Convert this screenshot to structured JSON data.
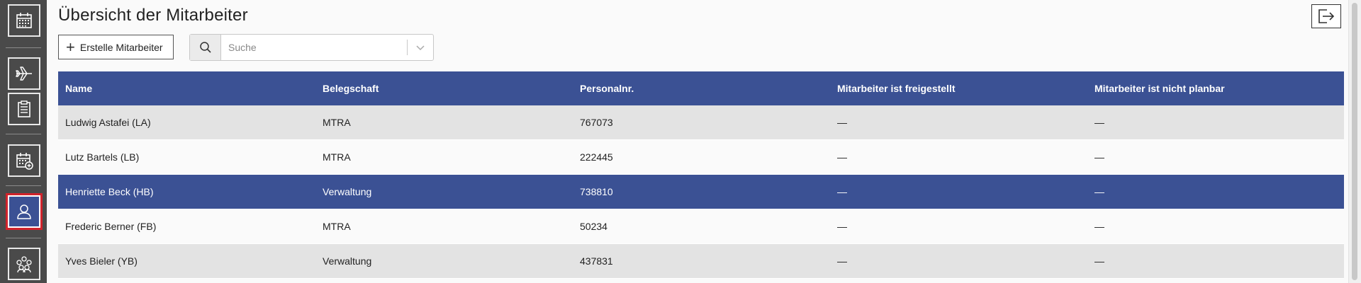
{
  "sidebar": {
    "items": [
      {
        "name": "calendar",
        "icon": "calendar-icon"
      },
      {
        "name": "flight",
        "icon": "airplane-icon"
      },
      {
        "name": "clipboard",
        "icon": "clipboard-icon"
      },
      {
        "name": "calendar-add",
        "icon": "calendar-plus-icon"
      },
      {
        "name": "employee",
        "icon": "user-icon",
        "active": true
      },
      {
        "name": "groups",
        "icon": "group-icon"
      }
    ]
  },
  "header": {
    "title": "Übersicht der Mitarbeiter",
    "create_label": "Erstelle Mitarbeiter",
    "search_placeholder": "Suche"
  },
  "colors": {
    "accent": "#3b5194",
    "sidebar_bg": "#4a4a4a",
    "active_outline": "#d0232b",
    "row_alt": "#e3e3e3"
  },
  "table": {
    "columns": [
      "Name",
      "Belegschaft",
      "Personalnr.",
      "Mitarbeiter ist freigestellt",
      "Mitarbeiter ist nicht planbar"
    ],
    "rows": [
      {
        "name": "Ludwig Astafei (LA)",
        "staff": "MTRA",
        "number": "767073",
        "released": "—",
        "not_plannable": "—"
      },
      {
        "name": "Lutz Bartels (LB)",
        "staff": "MTRA",
        "number": "222445",
        "released": "—",
        "not_plannable": "—"
      },
      {
        "name": "Henriette Beck (HB)",
        "staff": "Verwaltung",
        "number": "738810",
        "released": "—",
        "not_plannable": "—"
      },
      {
        "name": "Frederic Berner (FB)",
        "staff": "MTRA",
        "number": "50234",
        "released": "—",
        "not_plannable": "—"
      },
      {
        "name": "Yves Bieler (YB)",
        "staff": "Verwaltung",
        "number": "437831",
        "released": "—",
        "not_plannable": "—"
      }
    ],
    "selected_row": 2
  }
}
